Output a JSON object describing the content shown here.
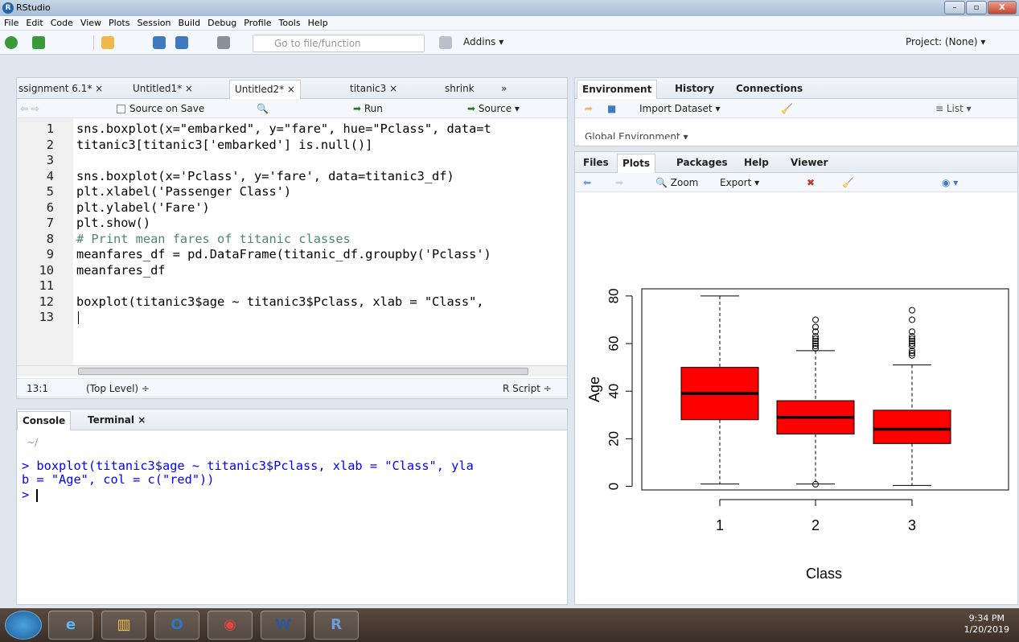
{
  "window": {
    "title": "RStudio",
    "logo": "R",
    "min": "–",
    "max": "▫",
    "close": "X"
  },
  "menu": [
    "File",
    "Edit",
    "Code",
    "View",
    "Plots",
    "Session",
    "Build",
    "Debug",
    "Profile",
    "Tools",
    "Help"
  ],
  "toolbar": {
    "goto_placeholder": "Go to file/function",
    "addins": "Addins ▾",
    "project": "Project: (None) ▾"
  },
  "source": {
    "tabs": [
      "ssignment 6.1* ×",
      "Untitled1* ×",
      "Untitled2* ×",
      "titanic3 ×",
      "shrink"
    ],
    "more": "»",
    "source_on_save": "Source on Save",
    "run": "Run",
    "source_btn": "Source ▾",
    "lines": [
      {
        "n": "1",
        "text": "sns.boxplot(x=\"embarked\", y=\"fare\", hue=\"Pclass\", data=t"
      },
      {
        "n": "2",
        "text": "titanic3[titanic3['embarked'] is.null()]"
      },
      {
        "n": "3",
        "text": ""
      },
      {
        "n": "4",
        "text": "sns.boxplot(x='Pclass', y='fare', data=titanic3_df)"
      },
      {
        "n": "5",
        "text": "plt.xlabel('Passenger Class')"
      },
      {
        "n": "6",
        "text": "plt.ylabel('Fare')"
      },
      {
        "n": "7",
        "text": "plt.show()"
      },
      {
        "n": "8",
        "text": "# Print mean fares of titanic classes"
      },
      {
        "n": "9",
        "text": "meanfares_df = pd.DataFrame(titanic_df.groupby('Pclass')"
      },
      {
        "n": "10",
        "text": "meanfares_df"
      },
      {
        "n": "11",
        "text": ""
      },
      {
        "n": "12",
        "text": "boxplot(titanic3$age ~ titanic3$Pclass, xlab = \"Class\","
      },
      {
        "n": "13",
        "text": ""
      }
    ],
    "status_pos": "13:1",
    "status_scope": "(Top Level) ÷",
    "status_type": "R Script ÷"
  },
  "console": {
    "tabs": [
      "Console",
      "Terminal ×"
    ],
    "path": "~/",
    "lines": [
      "> boxplot(titanic3$age ~ titanic3$Pclass, xlab = \"Class\", yla",
      "b = \"Age\", col = c(\"red\"))",
      "> "
    ]
  },
  "env": {
    "tabs": [
      "Environment",
      "History",
      "Connections"
    ],
    "import_dataset": "Import Dataset ▾",
    "list": "≡ List ▾",
    "global_env": "Global Environment ▾"
  },
  "files": {
    "tabs": [
      "Files",
      "Plots",
      "Packages",
      "Help",
      "Viewer"
    ],
    "zoom": "Zoom",
    "export": "Export ▾"
  },
  "chart_data": {
    "type": "box",
    "categories": [
      "1",
      "2",
      "3"
    ],
    "xlabel": "Class",
    "ylabel": "Age",
    "yticks": [
      0,
      20,
      40,
      60,
      80
    ],
    "ylim": [
      0,
      80
    ],
    "color": "#ff0000",
    "boxes": [
      {
        "min": 1,
        "q1": 28,
        "median": 39,
        "q3": 50,
        "max": 80,
        "outliers": []
      },
      {
        "min": 1,
        "q1": 22,
        "median": 29,
        "q3": 36,
        "max": 57,
        "outliers": [
          0.9,
          58,
          59,
          60,
          61,
          62,
          63,
          65,
          67,
          70
        ]
      },
      {
        "min": 0.4,
        "q1": 18,
        "median": 24,
        "q3": 32,
        "max": 51,
        "outliers": [
          55,
          56,
          57,
          59,
          60,
          61,
          62,
          63,
          65,
          70,
          74
        ]
      }
    ]
  },
  "taskbar": {
    "apps": [
      "start-orb",
      "ie",
      "explorer",
      "outlook",
      "chrome",
      "word",
      "rstudio"
    ],
    "time": "9:34 PM",
    "date": "1/20/2019"
  }
}
